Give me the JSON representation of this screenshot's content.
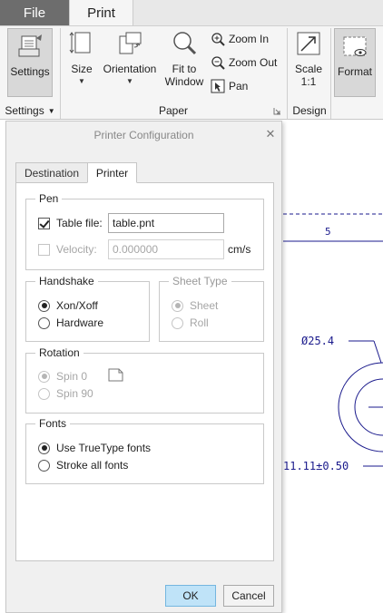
{
  "ribbon": {
    "tabs": {
      "file": "File",
      "print": "Print"
    },
    "buttons": {
      "settings": "Settings",
      "size": "Size",
      "orientation": "Orientation",
      "fit_line1": "Fit to",
      "fit_line2": "Window",
      "zoom_in": "Zoom In",
      "zoom_out": "Zoom Out",
      "pan": "Pan",
      "scale_line1": "Scale",
      "scale_line2": "1:1",
      "format": "Format"
    },
    "groups": {
      "settings": "Settings",
      "paper": "Paper",
      "design": "Design"
    },
    "icons": {
      "settings": "printer-settings-icon",
      "size": "paper-size-icon",
      "orientation": "orientation-icon",
      "fit": "magnifier-fit-icon",
      "zoom_in": "zoom-in-icon",
      "zoom_out": "zoom-out-icon",
      "pan": "pan-icon",
      "scale": "scale-arrow-icon",
      "format": "format-preview-icon"
    }
  },
  "dialog": {
    "title": "Printer Configuration",
    "close_symbol": "✕",
    "tabs": {
      "destination": "Destination",
      "printer": "Printer"
    },
    "pen": {
      "title": "Pen",
      "table_file_label": "Table file:",
      "table_file_checked": true,
      "table_file_value": "table.pnt",
      "velocity_label": "Velocity:",
      "velocity_checked": false,
      "velocity_value": "0.000000",
      "velocity_unit": "cm/s"
    },
    "handshake": {
      "title": "Handshake",
      "options": [
        {
          "label": "Xon/Xoff",
          "selected": true
        },
        {
          "label": "Hardware",
          "selected": false
        }
      ]
    },
    "sheet_type": {
      "title": "Sheet Type",
      "options": [
        {
          "label": "Sheet",
          "selected": true
        },
        {
          "label": "Roll",
          "selected": false
        }
      ]
    },
    "rotation": {
      "title": "Rotation",
      "options": [
        {
          "label": "Spin 0",
          "selected": true
        },
        {
          "label": "Spin 90",
          "selected": false
        }
      ]
    },
    "fonts": {
      "title": "Fonts",
      "options": [
        {
          "label": "Use TrueType fonts",
          "selected": true
        },
        {
          "label": "Stroke all fonts",
          "selected": false
        }
      ]
    },
    "buttons": {
      "ok": "OK",
      "cancel": "Cancel"
    }
  },
  "drawing": {
    "column_label": "5",
    "diameter_label": "Ø25.4",
    "tolerance_label": "11.11±0.50",
    "line_color": "#1a1a8c"
  }
}
